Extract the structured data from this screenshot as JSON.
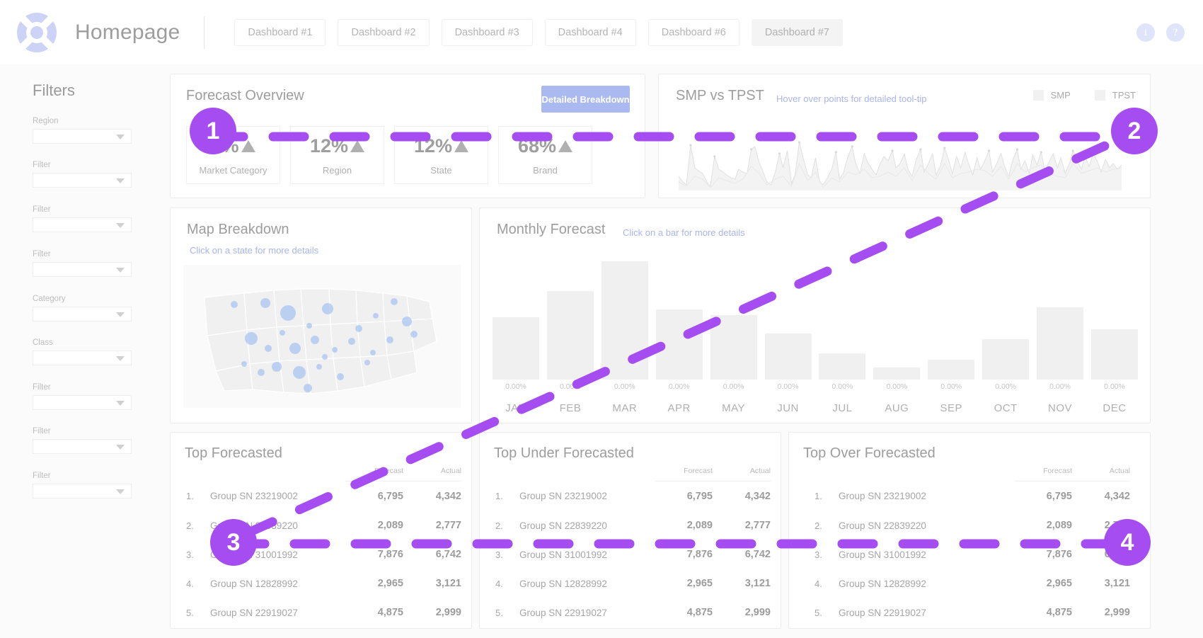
{
  "header": {
    "logo_icon": "lifebuoy-logo-icon",
    "title": "Homepage",
    "tabs": [
      {
        "label": "Dashboard #1",
        "active": false
      },
      {
        "label": "Dashboard #2",
        "active": false
      },
      {
        "label": "Dashboard #3",
        "active": false
      },
      {
        "label": "Dashboard #4",
        "active": false
      },
      {
        "label": "Dashboard #6",
        "active": false
      },
      {
        "label": "Dashboard #7",
        "active": true
      }
    ],
    "info_icon": "i",
    "help_icon": "?"
  },
  "sidebar": {
    "title": "Filters",
    "filters": [
      {
        "label": "Region",
        "value": ""
      },
      {
        "label": "Filter",
        "value": ""
      },
      {
        "label": "Filter",
        "value": ""
      },
      {
        "label": "Filter",
        "value": ""
      },
      {
        "label": "Category",
        "value": ""
      },
      {
        "label": "Class",
        "value": ""
      },
      {
        "label": "Filter",
        "value": ""
      },
      {
        "label": "Filter",
        "value": ""
      },
      {
        "label": "Filter",
        "value": ""
      }
    ]
  },
  "forecast_overview": {
    "title": "Forecast Overview",
    "button_label": "Detailed Breakdown",
    "kpis": [
      {
        "value": "8%",
        "trend": "up",
        "label": "Market Category"
      },
      {
        "value": "12%",
        "trend": "up",
        "label": "Region"
      },
      {
        "value": "12%",
        "trend": "up",
        "label": "State"
      },
      {
        "value": "68%",
        "trend": "up",
        "label": "Brand"
      }
    ]
  },
  "smp_vs_tpst": {
    "title": "SMP vs TPST",
    "subtitle": "Hover over points for detailed tool-tip",
    "legend": [
      {
        "label": "SMP"
      },
      {
        "label": "TPST"
      }
    ]
  },
  "map_breakdown": {
    "title": "Map Breakdown",
    "subtitle": "Click on a state for more details"
  },
  "monthly_forecast": {
    "title": "Monthly Forecast",
    "subtitle": "Click on a bar for more details"
  },
  "chart_data": [
    {
      "type": "bar",
      "title": "Monthly Forecast",
      "categories": [
        "JAN",
        "FEB",
        "MAR",
        "APR",
        "MAY",
        "JUN",
        "JUL",
        "AUG",
        "SEP",
        "OCT",
        "NOV",
        "DEC"
      ],
      "values": [
        62,
        88,
        118,
        70,
        64,
        46,
        26,
        12,
        20,
        40,
        72,
        50
      ],
      "data_labels": [
        "0.00%",
        "0.00%",
        "0.00%",
        "0.00%",
        "0.00%",
        "0.00%",
        "0.00%",
        "0.00%",
        "0.00%",
        "0.00%",
        "0.00%",
        "0.00%"
      ],
      "xlabel": "",
      "ylabel": "",
      "ylim": [
        0,
        120
      ],
      "grid": false,
      "legend_position": "none"
    },
    {
      "type": "area",
      "title": "SMP vs TPST",
      "series": [
        {
          "name": "SMP",
          "values": [
            18,
            8,
            6,
            72,
            34,
            30,
            22,
            10,
            5,
            44,
            28,
            26,
            20,
            16,
            14,
            30,
            26,
            24,
            58,
            64,
            40,
            26,
            12,
            8,
            22,
            50,
            30,
            58,
            10,
            24,
            76,
            42,
            20,
            16,
            44,
            10,
            6,
            18,
            30,
            58,
            14,
            26,
            46,
            64,
            38,
            24,
            54,
            40,
            30,
            22,
            36,
            48,
            42,
            56,
            30
          ]
        },
        {
          "name": "TPST",
          "values": [
            14,
            10,
            8,
            40,
            24,
            22,
            18,
            12,
            8,
            30,
            22,
            20,
            16,
            14,
            12,
            24,
            20,
            18,
            40,
            44,
            30,
            20,
            10,
            8,
            18,
            34,
            24,
            38,
            10,
            18,
            50,
            30,
            16,
            14,
            30,
            10,
            8,
            14,
            22,
            38,
            12,
            20,
            32,
            44,
            28,
            20,
            38,
            30,
            24,
            18,
            28,
            36,
            32,
            42,
            26
          ]
        }
      ],
      "xlabel": "",
      "ylabel": "",
      "grid": false,
      "legend_position": "top-right"
    }
  ],
  "tables": [
    {
      "title": "Top Forecasted",
      "columns": [
        "",
        "",
        "Forecast",
        "Actual"
      ],
      "rows": [
        {
          "rank": "1.",
          "name": "Group SN 23219002",
          "forecast": "6,795",
          "actual": "4,342"
        },
        {
          "rank": "2.",
          "name": "Group SN 22839220",
          "forecast": "2,089",
          "actual": "2,777"
        },
        {
          "rank": "3.",
          "name": "Group SN 31001992",
          "forecast": "7,876",
          "actual": "6,742"
        },
        {
          "rank": "4.",
          "name": "Group SN 12828992",
          "forecast": "2,965",
          "actual": "3,121"
        },
        {
          "rank": "5.",
          "name": "Group SN 22919027",
          "forecast": "4,875",
          "actual": "2,999"
        }
      ]
    },
    {
      "title": "Top Under Forecasted",
      "columns": [
        "",
        "",
        "Forecast",
        "Actual"
      ],
      "rows": [
        {
          "rank": "1.",
          "name": "Group SN 23219002",
          "forecast": "6,795",
          "actual": "4,342"
        },
        {
          "rank": "2.",
          "name": "Group SN 22839220",
          "forecast": "2,089",
          "actual": "2,777"
        },
        {
          "rank": "3.",
          "name": "Group SN 31001992",
          "forecast": "7,876",
          "actual": "6,742"
        },
        {
          "rank": "4.",
          "name": "Group SN 12828992",
          "forecast": "2,965",
          "actual": "3,121"
        },
        {
          "rank": "5.",
          "name": "Group SN 22919027",
          "forecast": "4,875",
          "actual": "2,999"
        }
      ]
    },
    {
      "title": "Top Over Forecasted",
      "columns": [
        "",
        "",
        "Forecast",
        "Actual"
      ],
      "rows": [
        {
          "rank": "1.",
          "name": "Group SN 23219002",
          "forecast": "6,795",
          "actual": "4,342"
        },
        {
          "rank": "2.",
          "name": "Group SN 22839220",
          "forecast": "2,089",
          "actual": "2,777"
        },
        {
          "rank": "3.",
          "name": "Group SN 31001992",
          "forecast": "7,876",
          "actual": "6,742"
        },
        {
          "rank": "4.",
          "name": "Group SN 12828992",
          "forecast": "2,965",
          "actual": "3,121"
        },
        {
          "rank": "5.",
          "name": "Group SN 22919027",
          "forecast": "4,875",
          "actual": "2,999"
        }
      ]
    }
  ],
  "annotations": {
    "accent_color": "#a54df0",
    "markers": [
      {
        "label": "1"
      },
      {
        "label": "2"
      },
      {
        "label": "3"
      },
      {
        "label": "4"
      }
    ]
  },
  "colors": {
    "accent_purple": "#a54df0",
    "brand_blue": "#aab9f0",
    "map_dot": "#a8c4f0",
    "bar_gray": "#f0f0f0"
  }
}
